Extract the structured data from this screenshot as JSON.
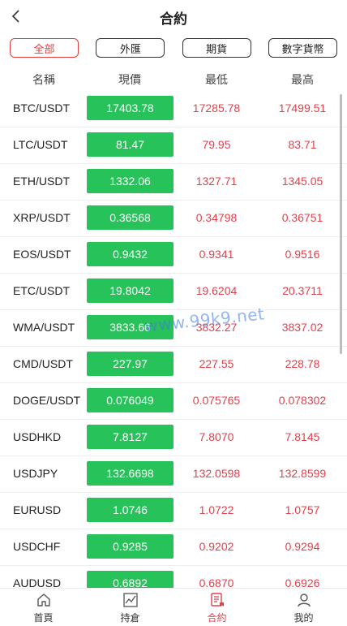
{
  "header": {
    "title": "合約"
  },
  "filters": [
    "全部",
    "外匯",
    "期貨",
    "數字貨幣"
  ],
  "columns": {
    "name": "名稱",
    "price": "現價",
    "low": "最低",
    "high": "最高"
  },
  "rows": [
    {
      "name": "BTC/USDT",
      "price": "17403.78",
      "low": "17285.78",
      "high": "17499.51"
    },
    {
      "name": "LTC/USDT",
      "price": "81.47",
      "low": "79.95",
      "high": "83.71"
    },
    {
      "name": "ETH/USDT",
      "price": "1332.06",
      "low": "1327.71",
      "high": "1345.05"
    },
    {
      "name": "XRP/USDT",
      "price": "0.36568",
      "low": "0.34798",
      "high": "0.36751"
    },
    {
      "name": "EOS/USDT",
      "price": "0.9432",
      "low": "0.9341",
      "high": "0.9516"
    },
    {
      "name": "ETC/USDT",
      "price": "19.8042",
      "low": "19.6204",
      "high": "20.3711"
    },
    {
      "name": "WMA/USDT",
      "price": "3833.66",
      "low": "3832.27",
      "high": "3837.02"
    },
    {
      "name": "CMD/USDT",
      "price": "227.97",
      "low": "227.55",
      "high": "228.78"
    },
    {
      "name": "DOGE/USDT",
      "price": "0.076049",
      "low": "0.075765",
      "high": "0.078302"
    },
    {
      "name": "USDHKD",
      "price": "7.8127",
      "low": "7.8070",
      "high": "7.8145"
    },
    {
      "name": "USDJPY",
      "price": "132.6698",
      "low": "132.0598",
      "high": "132.8599"
    },
    {
      "name": "EURUSD",
      "price": "1.0746",
      "low": "1.0722",
      "high": "1.0757"
    },
    {
      "name": "USDCHF",
      "price": "0.9285",
      "low": "0.9202",
      "high": "0.9294"
    },
    {
      "name": "AUDUSD",
      "price": "0.6892",
      "low": "0.6870",
      "high": "0.6926"
    }
  ],
  "watermark": "www.99k9.net",
  "tabs": [
    {
      "label": "首頁",
      "icon": "home-icon"
    },
    {
      "label": "持倉",
      "icon": "chart-icon"
    },
    {
      "label": "合約",
      "icon": "contract-icon"
    },
    {
      "label": "我的",
      "icon": "user-icon"
    }
  ],
  "colors": {
    "accent": "#e0424d",
    "price_bg": "#27c25a"
  }
}
